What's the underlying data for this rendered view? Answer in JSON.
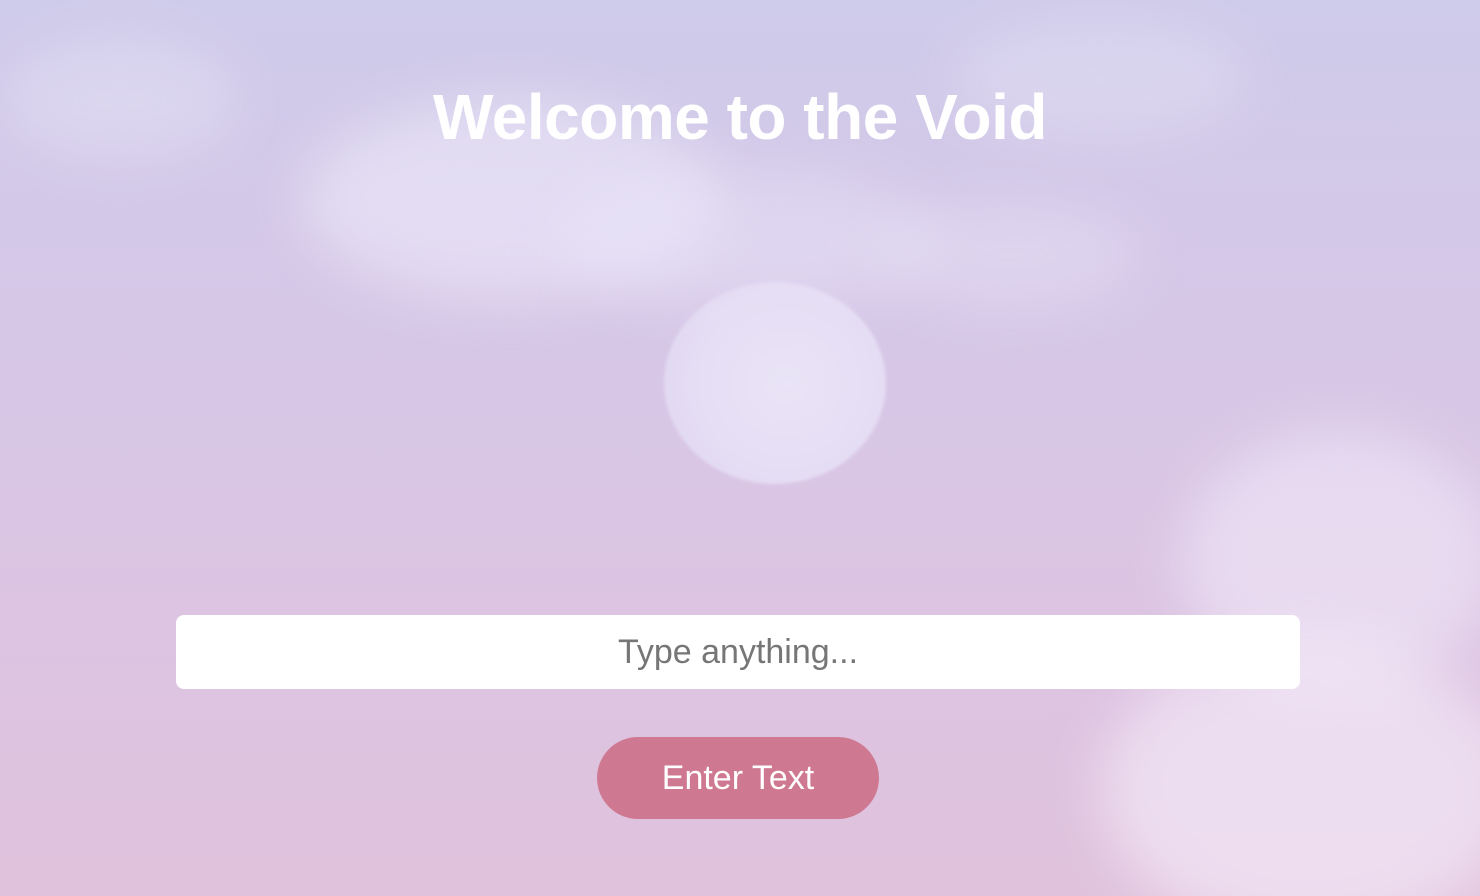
{
  "page": {
    "title": "Welcome to the Void",
    "background": "pastel-sky-with-moon",
    "colors": {
      "title_text": "#ffffff",
      "button_bg": "#cf7891",
      "button_text": "#ffffff",
      "input_bg": "#ffffff",
      "placeholder_text": "#767676"
    }
  },
  "form": {
    "input_placeholder": "Type anything...",
    "input_value": "",
    "submit_label": "Enter Text"
  }
}
